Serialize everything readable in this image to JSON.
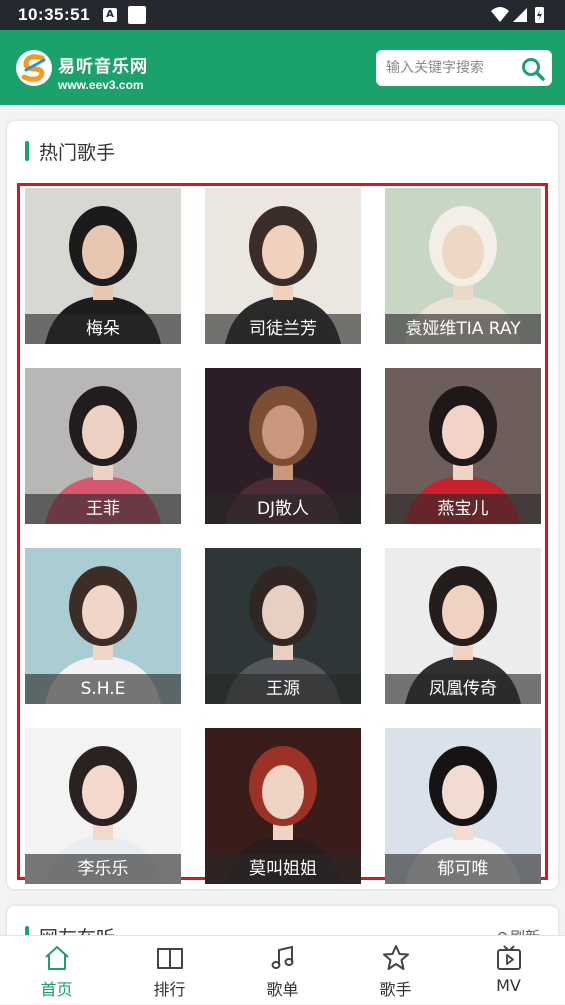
{
  "status": {
    "time": "10:35:51",
    "badge": "A"
  },
  "header": {
    "logo_name": "易听音乐网",
    "logo_url": "www.eev3.com",
    "search_placeholder": "输入关键字搜索"
  },
  "section_title": "热门歌手",
  "singers": [
    {
      "name": "梅朵",
      "tone": "#d9d7d2",
      "hair": "#1c1a1a",
      "skin": "#e8c7b2",
      "cloth": "#1d1d1d"
    },
    {
      "name": "司徒兰芳",
      "tone": "#ece6e0",
      "hair": "#3a2d28",
      "skin": "#f1d0bd",
      "cloth": "#2b2b2b"
    },
    {
      "name": "袁娅维TIA RAY",
      "tone": "#c8d6c4",
      "hair": "#f3efe6",
      "skin": "#edd7c6",
      "cloth": "#e9e3d8"
    },
    {
      "name": "王菲",
      "tone": "#b9b6b6",
      "hair": "#221c1d",
      "skin": "#ecd1c4",
      "cloth": "#d8566f"
    },
    {
      "name": "DJ散人",
      "tone": "#2c1d26",
      "hair": "#7d4e33",
      "skin": "#c9977b",
      "cloth": "#4a2b36"
    },
    {
      "name": "燕宝儿",
      "tone": "#6e5e5b",
      "hair": "#1f1718",
      "skin": "#f1d4c7",
      "cloth": "#c8202c"
    },
    {
      "name": "S.H.E",
      "tone": "#a9cdd2",
      "hair": "#3c2d26",
      "skin": "#f0d6c8",
      "cloth": "#f2f2f2"
    },
    {
      "name": "王源",
      "tone": "#2f3638",
      "hair": "#302624",
      "skin": "#e7cfc2",
      "cloth": "#55585a"
    },
    {
      "name": "凤凰传奇",
      "tone": "#ececec",
      "hair": "#251d1b",
      "skin": "#efd2c2",
      "cloth": "#303030"
    },
    {
      "name": "李乐乐",
      "tone": "#f3f3f3",
      "hair": "#2a2220",
      "skin": "#f2d9cc",
      "cloth": "#e8edf2"
    },
    {
      "name": "莫叫姐姐",
      "tone": "#3a1d1a",
      "hair": "#9c3225",
      "skin": "#efd3c5",
      "cloth": "#2b1c1c"
    },
    {
      "name": "郁可唯",
      "tone": "#d9e1ea",
      "hair": "#151313",
      "skin": "#f2dbd1",
      "cloth": "#f6f6f6"
    }
  ],
  "section2_title": "网友在听",
  "refresh_label": "刷新",
  "tabs": [
    {
      "label": "首页",
      "icon": "home-icon",
      "active": true
    },
    {
      "label": "排行",
      "icon": "book-icon",
      "active": false
    },
    {
      "label": "歌单",
      "icon": "music-note-icon",
      "active": false
    },
    {
      "label": "歌手",
      "icon": "star-icon",
      "active": false
    },
    {
      "label": "MV",
      "icon": "tv-play-icon",
      "active": false
    }
  ],
  "colors": {
    "brand": "#1ba16b",
    "highlight_frame": "#e0151b",
    "statusbar": "#25282f"
  }
}
